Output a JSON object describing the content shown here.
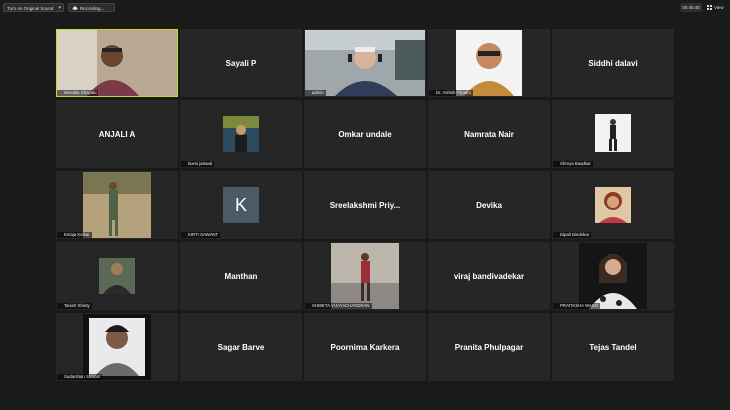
{
  "toolbar": {
    "original_sound_label": "Turn on Original Sound",
    "recording_label": "Recording...",
    "timer": "00:45:48",
    "view_label": "View"
  },
  "participants": [
    {
      "id": "p1",
      "name": "Nivedita Dhayalu",
      "display": "video",
      "active": true
    },
    {
      "id": "p2",
      "name": "Sayali P",
      "display": "name"
    },
    {
      "id": "p3",
      "name": "admin",
      "display": "video"
    },
    {
      "id": "p4",
      "name": "Dr. Ashish Tripathi",
      "display": "video"
    },
    {
      "id": "p5",
      "name": "Siddhi dalavi",
      "display": "name"
    },
    {
      "id": "p6",
      "name": "ANJALI A",
      "display": "name"
    },
    {
      "id": "p7",
      "name": "laxmi jaiswal",
      "display": "photo"
    },
    {
      "id": "p8",
      "name": "Omkar undale",
      "display": "name"
    },
    {
      "id": "p9",
      "name": "Namrata Nair",
      "display": "name"
    },
    {
      "id": "p10",
      "name": "Shreya Baadkar",
      "display": "photo"
    },
    {
      "id": "p11",
      "name": "Ketaja Kelkar",
      "display": "photo"
    },
    {
      "id": "p12",
      "name": "KIRTI SAWANT",
      "display": "avatar",
      "initial": "K"
    },
    {
      "id": "p13",
      "name": "Sreelakshmi  Priy...",
      "display": "name"
    },
    {
      "id": "p14",
      "name": "Devika",
      "display": "name"
    },
    {
      "id": "p15",
      "name": "Dipali Dindekar",
      "display": "photo"
    },
    {
      "id": "p16",
      "name": "Tanish Shetty",
      "display": "photo"
    },
    {
      "id": "p17",
      "name": "Manthan",
      "display": "name"
    },
    {
      "id": "p18",
      "name": "SHWETA VIJAYACHANDRAN",
      "display": "photo"
    },
    {
      "id": "p19",
      "name": "viraj bandivadekar",
      "display": "name"
    },
    {
      "id": "p20",
      "name": "PRATIKSHA WAGH",
      "display": "photo"
    },
    {
      "id": "p21",
      "name": "Sudarshan Sawant",
      "display": "photo"
    },
    {
      "id": "p22",
      "name": "Sagar Barve",
      "display": "name"
    },
    {
      "id": "p23",
      "name": "Poornima Karkera",
      "display": "name"
    },
    {
      "id": "p24",
      "name": "Pranita Phulpagar",
      "display": "name"
    },
    {
      "id": "p25",
      "name": "Tejas Tandel",
      "display": "name"
    }
  ],
  "colors": {
    "background": "#1a1a1a",
    "tile": "#262626",
    "active_speaker": "#c9d72f",
    "mute_icon": "#e02828"
  }
}
